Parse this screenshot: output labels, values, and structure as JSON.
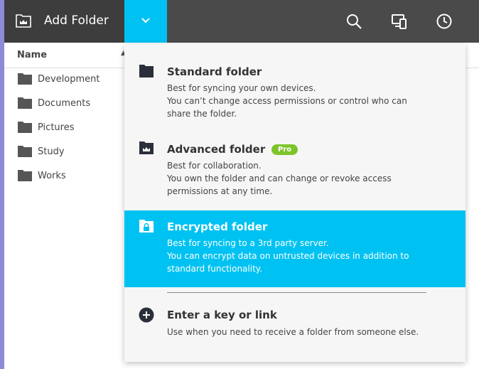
{
  "toolbar": {
    "add_folder_label": "Add Folder",
    "icons": [
      "folder-crown-icon",
      "chevron-down-icon",
      "search-icon",
      "devices-icon",
      "clock-icon"
    ]
  },
  "list": {
    "header_name": "Name",
    "items": [
      {
        "name": "Development"
      },
      {
        "name": "Documents"
      },
      {
        "name": "Pictures"
      },
      {
        "name": "Study"
      },
      {
        "name": "Works"
      }
    ]
  },
  "menu": {
    "standard": {
      "title": "Standard folder",
      "desc_lines": [
        "Best for syncing your own devices.",
        "You can’t change access permissions or control who can",
        "share the folder."
      ]
    },
    "advanced": {
      "title": "Advanced folder",
      "badge": "Pro",
      "desc_lines": [
        "Best for collaboration.",
        "You own the folder and can change or revoke access",
        "permissions at any time."
      ]
    },
    "encrypted": {
      "title": "Encrypted folder",
      "desc_lines": [
        "Best for syncing to a 3rd party server.",
        "You can encrypt data on untrusted devices in addition to",
        "standard functionality."
      ]
    },
    "key": {
      "title": "Enter a key or link",
      "desc_lines": [
        "Use when you need to receive a folder from someone else."
      ]
    }
  },
  "colors": {
    "accent": "#00c2f2",
    "toolbar": "#4a4a4a",
    "pro_badge": "#7dc42a",
    "left_edge": "#8d8bd6"
  }
}
